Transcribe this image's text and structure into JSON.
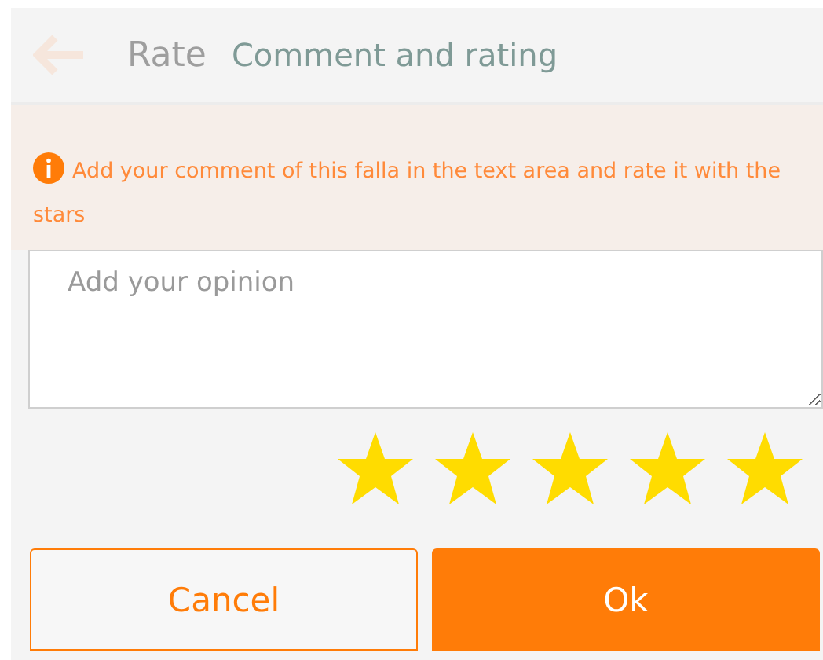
{
  "header": {
    "back_label": "Rate",
    "title": "Comment and rating"
  },
  "notice": {
    "text": "Add your comment of this falla in the text area and rate it with the stars"
  },
  "comment": {
    "placeholder": "Add your opinion"
  },
  "rating": {
    "stars": 5
  },
  "buttons": [
    {
      "label": "Cancel",
      "kind": "secondary"
    },
    {
      "label": "Ok",
      "kind": "primary"
    }
  ]
}
